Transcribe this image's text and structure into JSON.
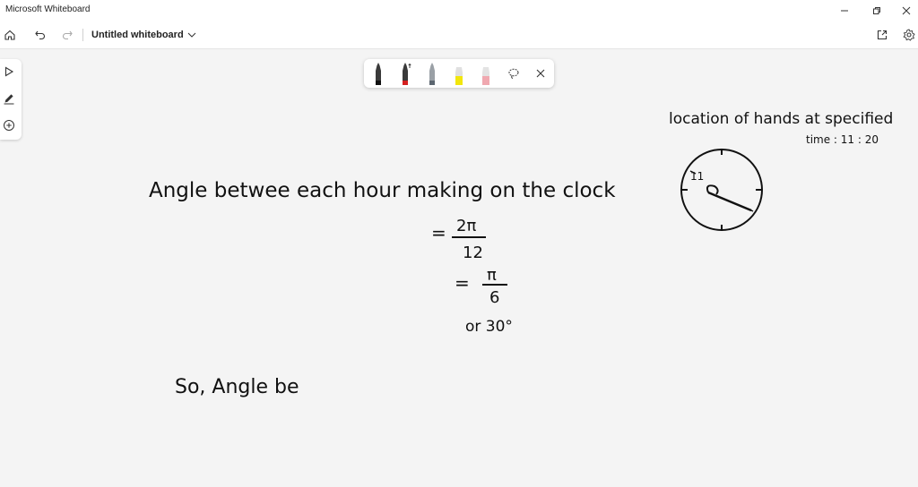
{
  "window": {
    "app_title": "Microsoft Whiteboard",
    "controls": [
      "minimize",
      "restore",
      "close"
    ]
  },
  "toolbar": {
    "board_title": "Untitled whiteboard",
    "icons": [
      "home-icon",
      "undo-icon",
      "redo-icon",
      "chevron-down-icon",
      "share-icon",
      "settings-icon"
    ]
  },
  "left_rail": {
    "tools": [
      "select-tool",
      "pen-tool",
      "add-tool"
    ]
  },
  "pen_tray": {
    "pens": [
      {
        "name": "black-pen",
        "color": "#111111"
      },
      {
        "name": "red-pen",
        "color": "#d42020"
      },
      {
        "name": "grey-pen",
        "color": "#707070"
      },
      {
        "name": "yellow-highlighter",
        "color": "#f2e60c"
      },
      {
        "name": "pink-highlighter",
        "color": "#f0a8b0"
      }
    ],
    "icons": [
      "lasso-icon",
      "close-icon"
    ]
  },
  "canvas": {
    "note_heading": "location of hands at specified",
    "note_time": "time : 11 : 20",
    "line1": "Angle betwee each hour making on the clock",
    "eq1_sign": "=",
    "eq1_num": "2π",
    "eq1_den": "12",
    "eq2_sign": "=",
    "eq2_num": "π",
    "eq2_den": "6",
    "eq3": "or 30°",
    "line2": "So, Angle be",
    "clock_label": "11"
  }
}
